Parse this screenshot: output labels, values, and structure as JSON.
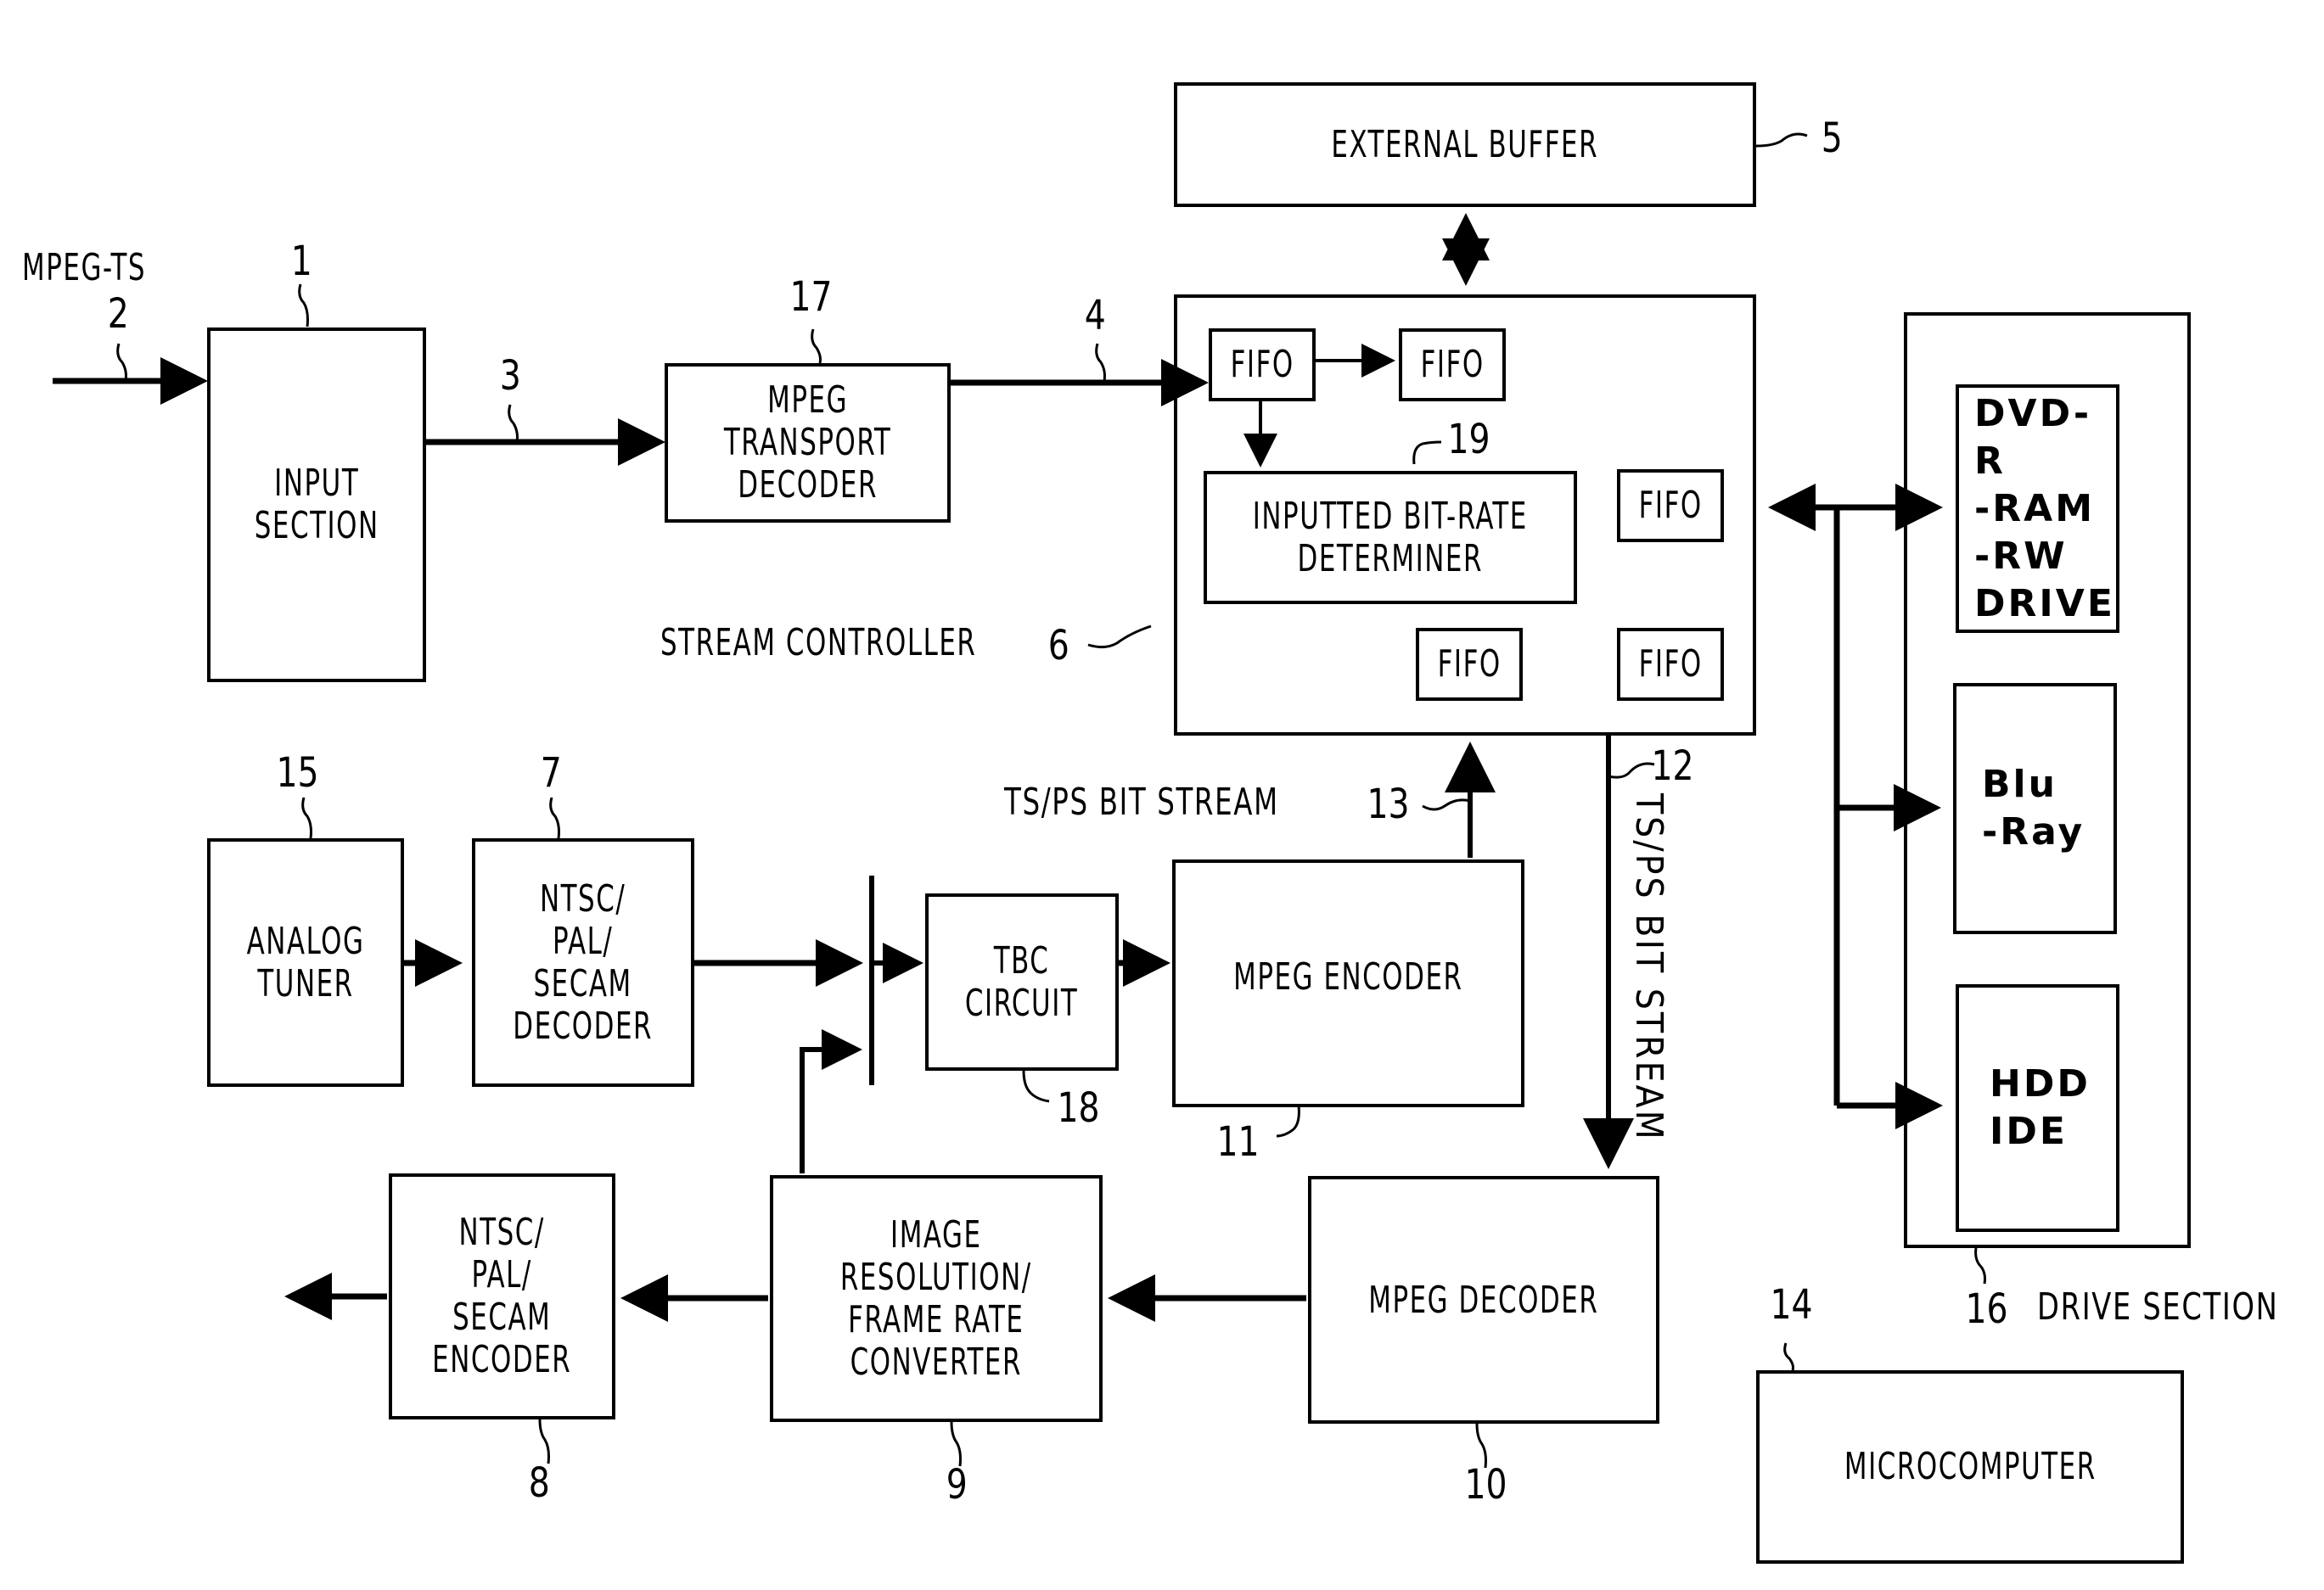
{
  "blocks": {
    "input_section": {
      "label": "INPUT\nSECTION",
      "ref": "1"
    },
    "mpeg_transport_decoder": {
      "label": "MPEG\nTRANSPORT\nDECODER",
      "ref": "17"
    },
    "external_buffer": {
      "label": "EXTERNAL  BUFFER",
      "ref": "5"
    },
    "stream_controller": {
      "label": "STREAM  CONTROLLER",
      "ref": "6"
    },
    "fifo_label": "FIFO",
    "bitrate_determiner": {
      "label": "INPUTTED BIT-RATE\nDETERMINER",
      "ref": "19"
    },
    "analog_tuner": {
      "label": "ANALOG\nTUNER",
      "ref": "15"
    },
    "ntsc_decoder": {
      "label": "NTSC/\nPAL/\nSECAM\nDECODER",
      "ref": "7"
    },
    "tbc_circuit": {
      "label": "TBC\nCIRCUIT",
      "ref": "18"
    },
    "mpeg_encoder": {
      "label": "MPEG  ENCODER",
      "ref": "11"
    },
    "ntsc_encoder": {
      "label": "NTSC/\nPAL/\nSECAM\nENCODER",
      "ref": "8"
    },
    "image_converter": {
      "label": "IMAGE\nRESOLUTION/\nFRAME RATE\nCONVERTER",
      "ref": "9"
    },
    "mpeg_decoder": {
      "label": "MPEG  DECODER",
      "ref": "10"
    },
    "drive_section": {
      "label": "DRIVE  SECTION",
      "ref": "16"
    },
    "dvd_drive": {
      "label": "DVD-R\n-RAM\n-RW\nDRIVE"
    },
    "bluray": {
      "label": "Blu\n-Ray"
    },
    "hdd": {
      "label": "HDD\nIDE"
    },
    "microcomputer": {
      "label": "MICROCOMPUTER",
      "ref": "14"
    }
  },
  "signals": {
    "mpeg_ts": {
      "label": "MPEG-TS",
      "ref": "2"
    },
    "line3": {
      "ref": "3"
    },
    "line4": {
      "ref": "4"
    },
    "ts_ps_13": {
      "label": "TS/PS  BIT  STREAM",
      "ref": "13"
    },
    "ts_ps_12": {
      "label": "TS/PS  BIT  STREAM",
      "ref": "12"
    }
  }
}
